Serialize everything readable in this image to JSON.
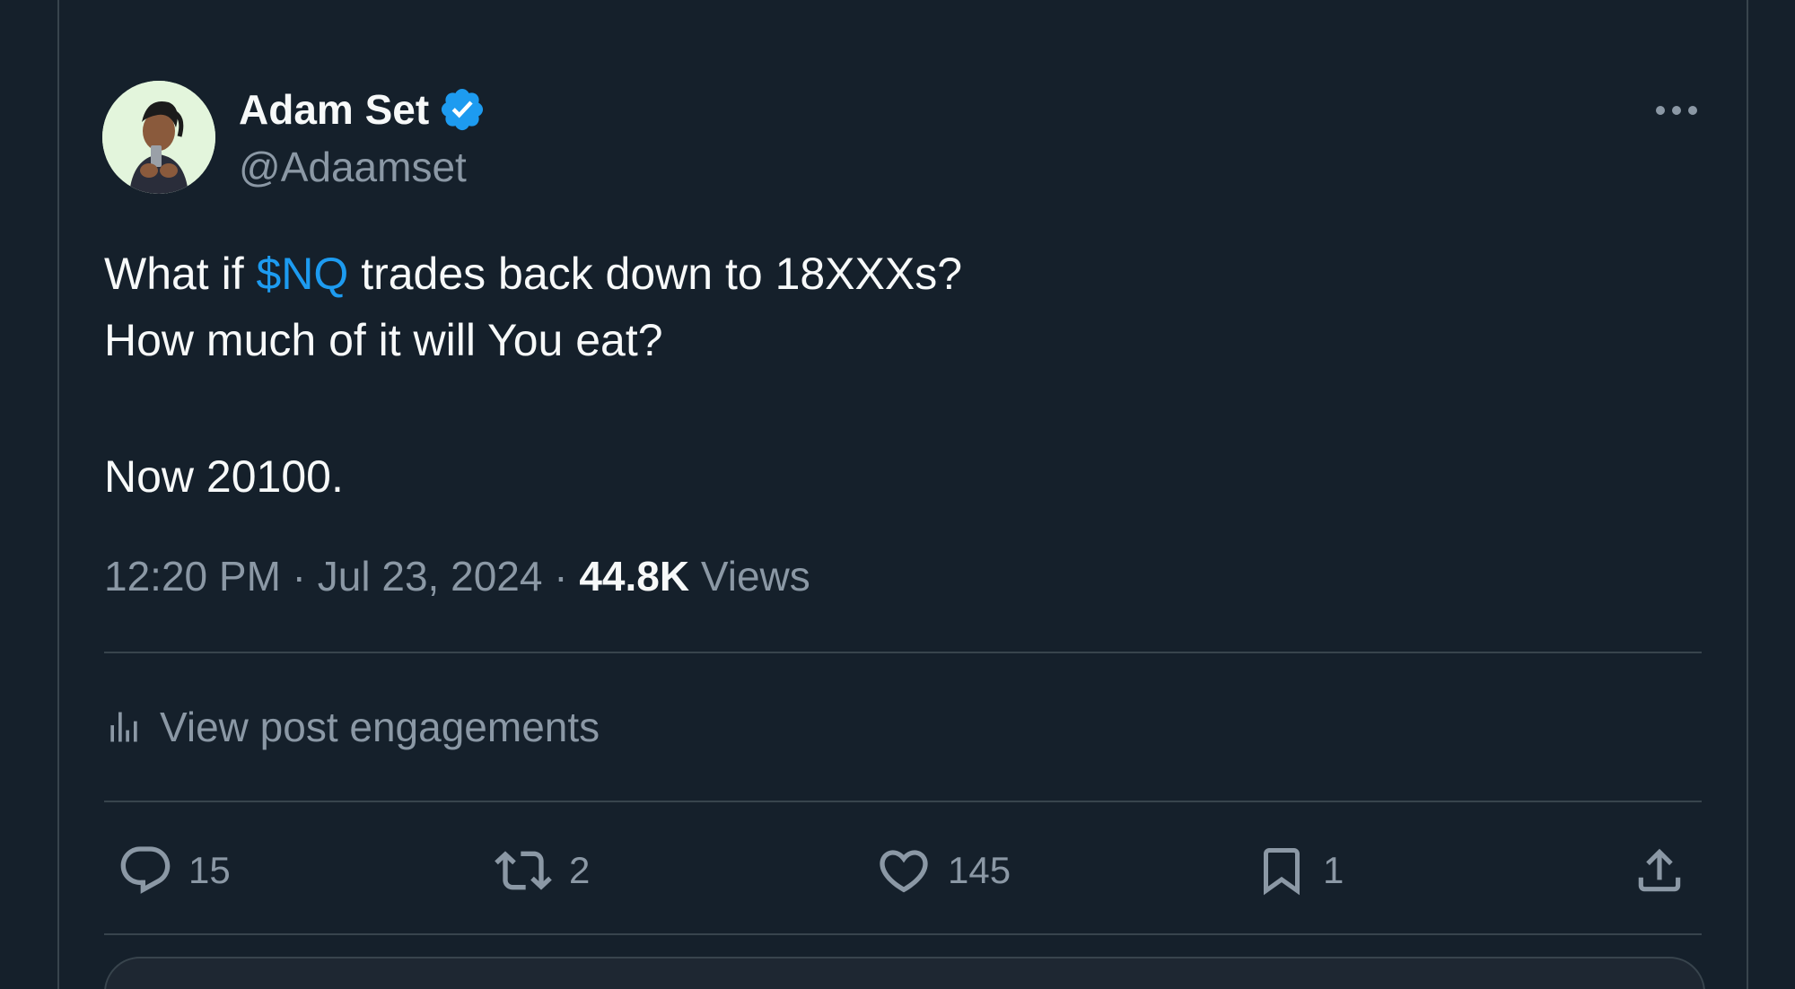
{
  "author": {
    "name": "Adam Set",
    "handle": "@Adaamset",
    "verified_color": "#1d9bf0"
  },
  "tweet": {
    "text_before_cashtag": "What if ",
    "cashtag": "$NQ",
    "text_after_cashtag": " trades back down to 18XXXs?",
    "line2": "How much of it will You eat?",
    "line3": "Now 20100."
  },
  "meta": {
    "time": "12:20 PM",
    "separator": " · ",
    "date": "Jul 23, 2024",
    "views_count": "44.8K",
    "views_label": "Views"
  },
  "engagements": {
    "label": "View post engagements",
    "icon": "bar-chart-icon"
  },
  "actions": {
    "reply": {
      "icon": "reply-icon",
      "count": "15"
    },
    "repost": {
      "icon": "repost-icon",
      "count": "2"
    },
    "like": {
      "icon": "heart-icon",
      "count": "145"
    },
    "bookmark": {
      "icon": "bookmark-icon",
      "count": "1"
    },
    "share": {
      "icon": "share-icon"
    }
  },
  "colors": {
    "background": "#15202b",
    "text_primary": "#f7f9f9",
    "text_secondary": "#8b98a5",
    "accent": "#1d9bf0",
    "border": "#38444d"
  }
}
